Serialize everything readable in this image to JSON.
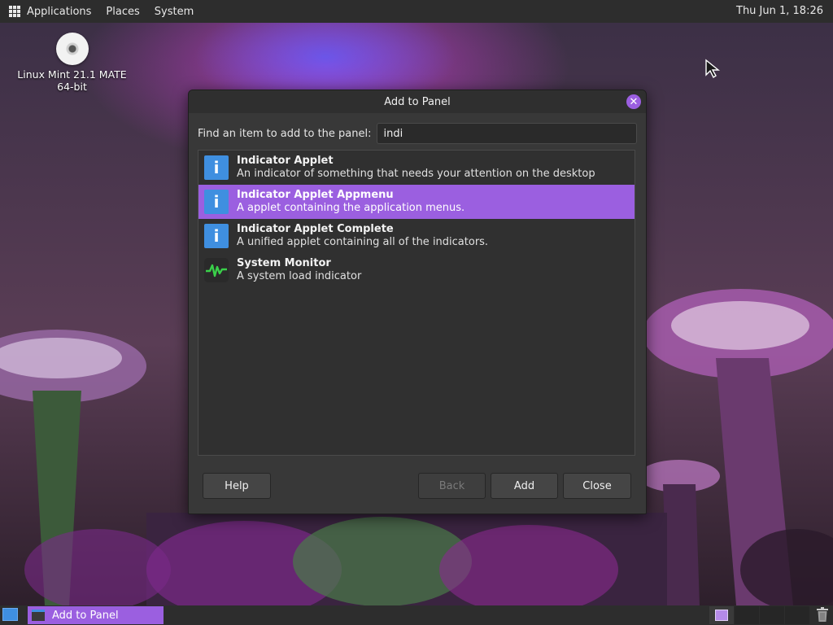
{
  "top_panel": {
    "menus": [
      "Applications",
      "Places",
      "System"
    ],
    "clock": "Thu Jun  1, 18:26"
  },
  "desktop_icon": {
    "line1": "Linux Mint 21.1 MATE",
    "line2": "64-bit"
  },
  "dialog": {
    "title": "Add to Panel",
    "find_label": "Find an item to add to the panel:",
    "search_value": "indi",
    "items": [
      {
        "name": "Indicator Applet",
        "desc": "An indicator of something that needs your attention on the desktop",
        "icon": "info-icon",
        "selected": false
      },
      {
        "name": "Indicator Applet Appmenu",
        "desc": "A applet containing the application menus.",
        "icon": "info-icon",
        "selected": true
      },
      {
        "name": "Indicator Applet Complete",
        "desc": "A unified applet containing all of the indicators.",
        "icon": "info-icon",
        "selected": false
      },
      {
        "name": "System Monitor",
        "desc": "A system load indicator",
        "icon": "system-monitor-icon",
        "selected": false
      }
    ],
    "buttons": {
      "help": "Help",
      "back": "Back",
      "add": "Add",
      "close": "Close"
    }
  },
  "taskbar": {
    "task_label": "Add to Panel"
  },
  "colors": {
    "accent": "#9b5fe0",
    "panel": "#2d2d2d",
    "dialog_bg": "#383838",
    "info_icon": "#3f8fe0"
  }
}
